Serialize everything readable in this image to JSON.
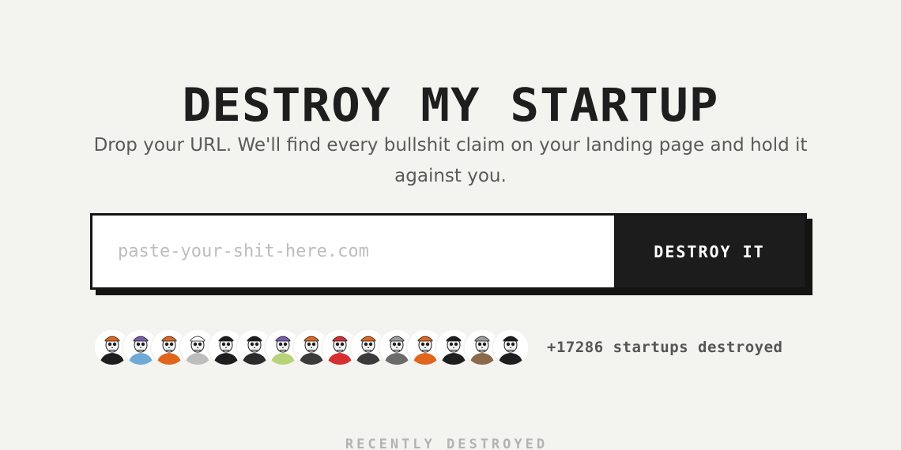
{
  "hero": {
    "title": "DESTROY MY STARTUP",
    "subtitle": "Drop your URL. We'll find every bullshit claim on your landing page and hold it against you."
  },
  "form": {
    "url_placeholder": "paste-your-shit-here.com",
    "url_value": "",
    "submit_label": "DESTROY IT"
  },
  "social_proof": {
    "avatars": [
      {
        "name": "skeleton-avatar-icon",
        "hat": "#e0661e",
        "body": "#1e1e1e"
      },
      {
        "name": "skeleton-avatar-icon",
        "hat": "#7a5bb0",
        "body": "#6fa9d6"
      },
      {
        "name": "skeleton-avatar-icon",
        "hat": "#e0661e",
        "body": "#e0661e"
      },
      {
        "name": "skeleton-avatar-icon",
        "hat": "#ffffff",
        "body": "#bdbdbd"
      },
      {
        "name": "skeleton-avatar-icon",
        "hat": "#1e1e1e",
        "body": "#1e1e1e"
      },
      {
        "name": "skeleton-avatar-icon",
        "hat": "#1e1e1e",
        "body": "#2b2b2b"
      },
      {
        "name": "skeleton-avatar-icon",
        "hat": "#7a5bb0",
        "body": "#b7d37a"
      },
      {
        "name": "skeleton-avatar-icon",
        "hat": "#e0661e",
        "body": "#3b3b3b"
      },
      {
        "name": "skeleton-avatar-icon",
        "hat": "#d62f2f",
        "body": "#d62f2f"
      },
      {
        "name": "skeleton-avatar-icon",
        "hat": "#e0661e",
        "body": "#3b3b3b"
      },
      {
        "name": "skeleton-avatar-icon",
        "hat": "#9a9a9a",
        "body": "#6b6b6b"
      },
      {
        "name": "skeleton-avatar-icon",
        "hat": "#e0661e",
        "body": "#e0661e"
      },
      {
        "name": "skeleton-avatar-icon",
        "hat": "#1e1e1e",
        "body": "#1e1e1e"
      },
      {
        "name": "skeleton-avatar-icon",
        "hat": "#9a9a9a",
        "body": "#8a6a4a"
      },
      {
        "name": "skeleton-avatar-icon",
        "hat": "#1e1e1e",
        "body": "#1e1e1e"
      }
    ],
    "count_text": "+17286 startups destroyed"
  },
  "recent": {
    "heading": "RECENTLY DESTROYED"
  },
  "colors": {
    "background": "#f3f3ef",
    "ink": "#1e1e1e",
    "muted": "#5a5a5a",
    "accent": "#e0661e"
  }
}
